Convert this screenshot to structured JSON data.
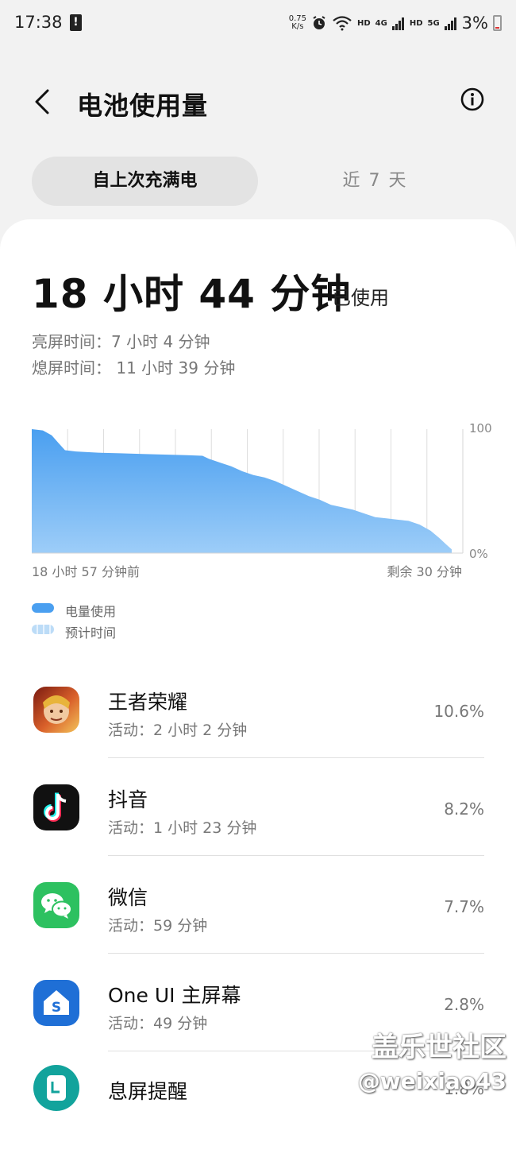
{
  "status_bar": {
    "time": "17:38",
    "alert_icon": "!",
    "net_speed_value": "0.75",
    "net_speed_unit": "K/s",
    "hd1": "HD",
    "net1": "4G",
    "hd2": "HD",
    "net2": "5G",
    "battery": "3%"
  },
  "header": {
    "title": "电池使用量",
    "back_icon": "chevron-left",
    "info_icon": "info-circle"
  },
  "tabs": [
    {
      "label": "自上次充满电",
      "active": true
    },
    {
      "label": "近 7 天",
      "active": false
    }
  ],
  "summary": {
    "total": "18 小时 44 分钟",
    "suffix": "已使用",
    "screen_on": "亮屏时间：7 小时 4 分钟",
    "screen_off": "熄屏时间： 11 小时 39 分钟"
  },
  "chart_data": {
    "type": "area",
    "y_top_label": "100",
    "y_bottom_label": "0%",
    "x_start_label": "18 小时 57 分钟前",
    "x_end_label": "剩余 30 分钟",
    "ylim": [
      0,
      100
    ],
    "x_hours": [
      0,
      0.5,
      0.9,
      1.2,
      1.5,
      2.0,
      3.0,
      4.0,
      5.0,
      6.0,
      7.0,
      7.7,
      8.0,
      8.5,
      9.0,
      9.5,
      10.0,
      10.5,
      11.0,
      11.5,
      12.0,
      12.5,
      13.0,
      13.5,
      14.0,
      14.5,
      15.0,
      15.5,
      16.0,
      16.5,
      17.0,
      17.5,
      18.0,
      18.4,
      18.7,
      18.95
    ],
    "battery_percent": [
      100,
      99,
      95,
      89,
      83,
      82,
      81,
      80.5,
      80,
      79.5,
      79,
      78.5,
      76,
      73,
      70,
      66,
      63,
      61,
      58,
      54,
      50,
      46,
      43,
      39,
      37,
      35,
      32,
      29,
      28,
      27,
      26,
      23,
      18,
      12,
      7,
      3
    ],
    "fill_color": "#5aa9f0",
    "grid": "vertical"
  },
  "legend": [
    {
      "label": "电量使用",
      "color": "#4a9ff0",
      "style": "solid"
    },
    {
      "label": "预计时间",
      "color": "#bcdcf7",
      "style": "dashed"
    }
  ],
  "apps": [
    {
      "name": "王者荣耀",
      "activity": "活动：2 小时 2 分钟",
      "percent": "10.6%",
      "icon": "honor-of-kings-icon"
    },
    {
      "name": "抖音",
      "activity": "活动：1 小时 23 分钟",
      "percent": "8.2%",
      "icon": "douyin-icon"
    },
    {
      "name": "微信",
      "activity": "活动：59 分钟",
      "percent": "7.7%",
      "icon": "wechat-icon"
    },
    {
      "name": "One UI 主屏幕",
      "activity": "活动：49 分钟",
      "percent": "2.8%",
      "icon": "one-ui-home-icon"
    },
    {
      "name": "息屏提醒",
      "activity": "",
      "percent": "1.8%",
      "icon": "always-on-display-icon"
    }
  ],
  "watermark": {
    "line1": "盖乐世社区",
    "line2": "@weixiao43"
  }
}
